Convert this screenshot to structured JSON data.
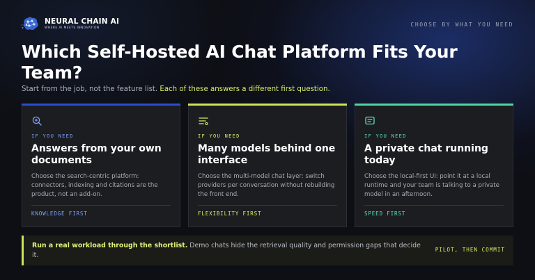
{
  "brand": {
    "name": "NEURAL CHAIN AI",
    "tagline": "WHERE AI MEETS INNOVATION"
  },
  "header": {
    "eyebrow": "CHOOSE BY WHAT YOU NEED",
    "title": "Which Self-Hosted AI Chat Platform Fits Your Team?",
    "subtitle_plain": "Start from the job, not the feature list.",
    "subtitle_highlight": "Each of these answers a different first question."
  },
  "cards": [
    {
      "icon": "magnifier-plus-icon",
      "kicker": "IF YOU NEED",
      "heading": "Answers from your own documents",
      "description": "Choose the search-centric platform: connectors, indexing and citations are the product, not an add-on.",
      "footer": "KNOWLEDGE FIRST",
      "accent": "#2a4fd0"
    },
    {
      "icon": "list-lines-icon",
      "kicker": "IF YOU NEED",
      "heading": "Many models behind one interface",
      "description": "Choose the multi-model chat layer: switch providers per conversation without rebuilding the front end.",
      "footer": "FLEXIBILITY FIRST",
      "accent": "#cfe35a"
    },
    {
      "icon": "chat-box-icon",
      "kicker": "IF YOU NEED",
      "heading": "A private chat running today",
      "description": "Choose the local-first UI: point it at a local runtime and your team is talking to a private model in an afternoon.",
      "footer": "SPEED FIRST",
      "accent": "#4fd6a3"
    }
  ],
  "callout": {
    "bold": "Run a real workload through the shortlist.",
    "rest": "Demo chats hide the retrieval quality and permission gaps that decide it.",
    "tag": "PILOT, THEN COMMIT"
  }
}
